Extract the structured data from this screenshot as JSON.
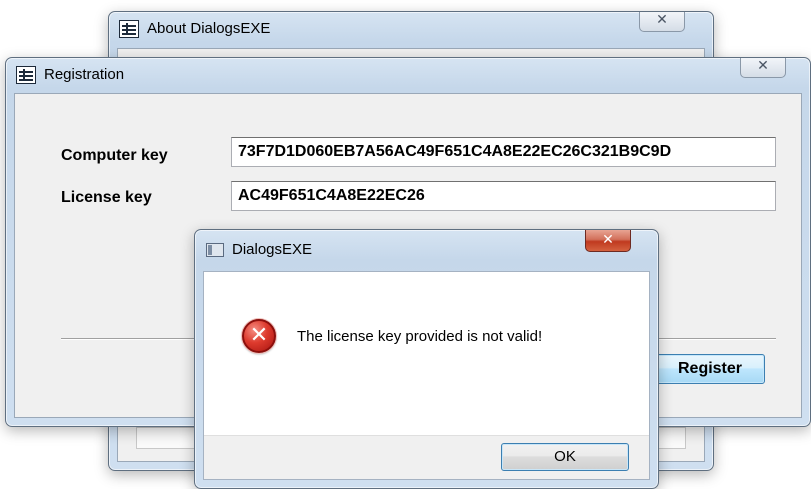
{
  "about_window": {
    "title": "About DialogsEXE",
    "close_glyph": "✕"
  },
  "registration_window": {
    "title": "Registration",
    "close_glyph": "✕",
    "computer_key_label": "Computer key",
    "computer_key_value": "73F7D1D060EB7A56AC49F651C4A8E22EC26C321B9C9D",
    "license_key_label": "License key",
    "license_key_value": "AC49F651C4A8E22EC26",
    "register_label": "Register"
  },
  "message_box": {
    "title": "DialogsEXE",
    "close_glyph": "✕",
    "icon": "error-icon",
    "icon_glyph": "✕",
    "message": "The license key provided is not valid!",
    "ok_label": "OK"
  },
  "colors": {
    "close_red": "#c0391f",
    "button_border_focus": "#3c7fb1"
  }
}
